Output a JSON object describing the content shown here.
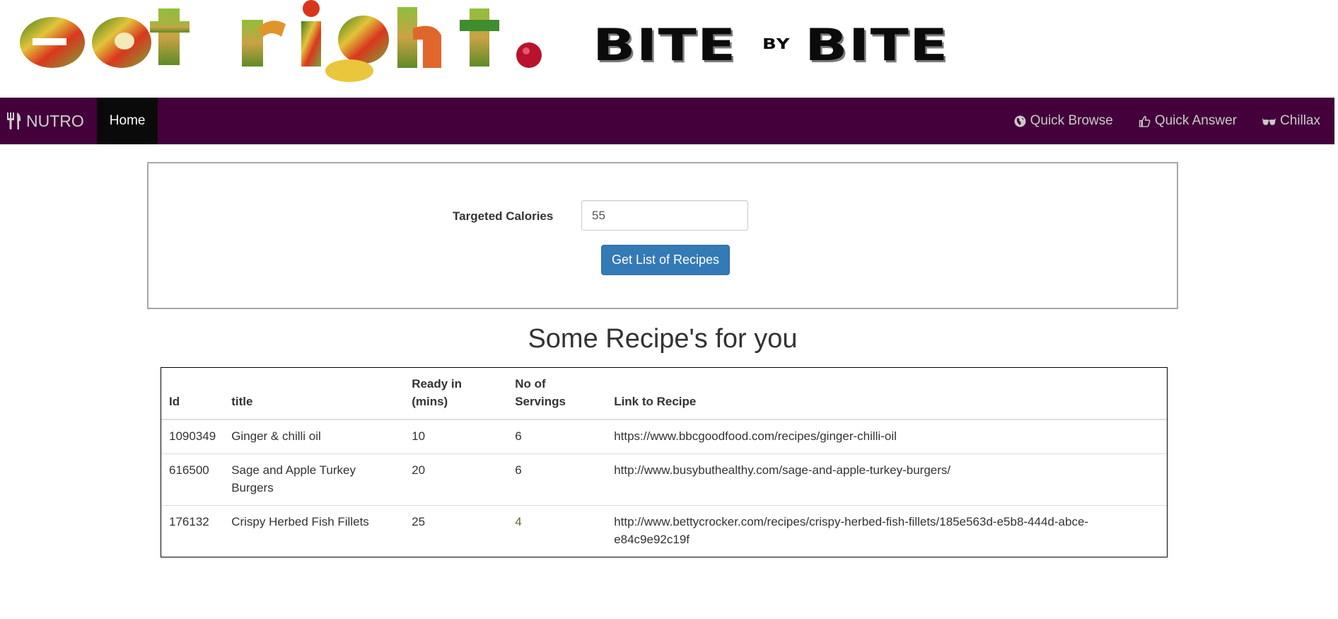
{
  "banner": {
    "logo_text": "eat right.",
    "tagline_word1": "BITE",
    "tagline_by": "BY",
    "tagline_word2": "BITE"
  },
  "navbar": {
    "brand_icon": "cutlery-icon",
    "brand": "NUTRO",
    "home": "Home",
    "links": [
      {
        "icon": "globe-icon",
        "label": "Quick Browse"
      },
      {
        "icon": "thumbs-up-icon",
        "label": "Quick Answer"
      },
      {
        "icon": "sunglasses-icon",
        "label": "Chillax"
      }
    ],
    "colors": {
      "background": "#43003a",
      "active": "#0a0a0a"
    }
  },
  "form": {
    "calories_label": "Targeted Calories",
    "calories_value": "55",
    "submit_label": "Get List of Recipes",
    "button_color": "#337ab7"
  },
  "results": {
    "title": "Some Recipe's for you",
    "headers": {
      "id": "Id",
      "title": "title",
      "ready_line1": "Ready in",
      "ready_line2": "(mins)",
      "servings_line1": "No of",
      "servings_line2": "Servings",
      "link": "Link to Recipe"
    },
    "rows": [
      {
        "id": "1090349",
        "title": "Ginger & chilli oil",
        "ready": "10",
        "servings": "6",
        "link": "https://www.bbcgoodfood.com/recipes/ginger-chilli-oil"
      },
      {
        "id": "616500",
        "title": "Sage and Apple Turkey Burgers",
        "ready": "20",
        "servings": "6",
        "link": "http://www.busybuthealthy.com/sage-and-apple-turkey-burgers/"
      },
      {
        "id": "176132",
        "title": "Crispy Herbed Fish Fillets",
        "ready": "25",
        "servings": "4",
        "link": "http://www.bettycrocker.com/recipes/crispy-herbed-fish-fillets/185e563d-e5b8-444d-abce-e84c9e92c19f"
      }
    ]
  }
}
